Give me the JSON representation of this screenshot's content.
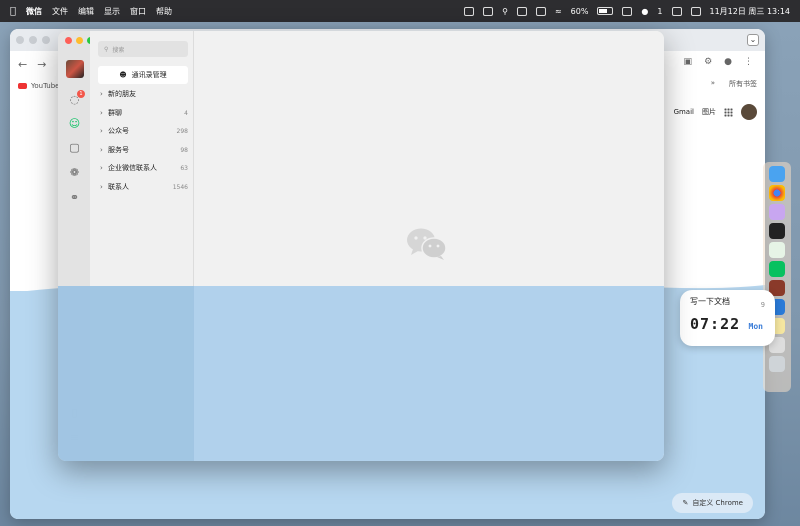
{
  "menubar": {
    "app_name": "微信",
    "menus": [
      "文件",
      "编辑",
      "显示",
      "窗口",
      "帮助"
    ],
    "battery": "60%",
    "wechat_count": "1",
    "datetime": "11月12日 周三  13:14"
  },
  "chrome": {
    "bookmark_youtube": "YouTube",
    "bookmark_all": "所有书签",
    "nav_gmail": "Gmail",
    "nav_images": "图片",
    "customize_label": "自定义 Chrome"
  },
  "widget": {
    "title": "写一下文档",
    "count": "9",
    "time": "07:22",
    "day": "Mon"
  },
  "wechat": {
    "search_placeholder": "搜索",
    "manage_label": "通讯录管理",
    "badge": "1",
    "rows": [
      {
        "label": "新的朋友",
        "count": ""
      },
      {
        "label": "群聊",
        "count": "4"
      },
      {
        "label": "公众号",
        "count": "298"
      },
      {
        "label": "服务号",
        "count": "98"
      },
      {
        "label": "企业微信联系人",
        "count": "63"
      },
      {
        "label": "联系人",
        "count": "1546"
      }
    ]
  },
  "colors": {
    "accent": "#07c160",
    "water": "#b7d7f0",
    "badge": "#f2564a"
  }
}
